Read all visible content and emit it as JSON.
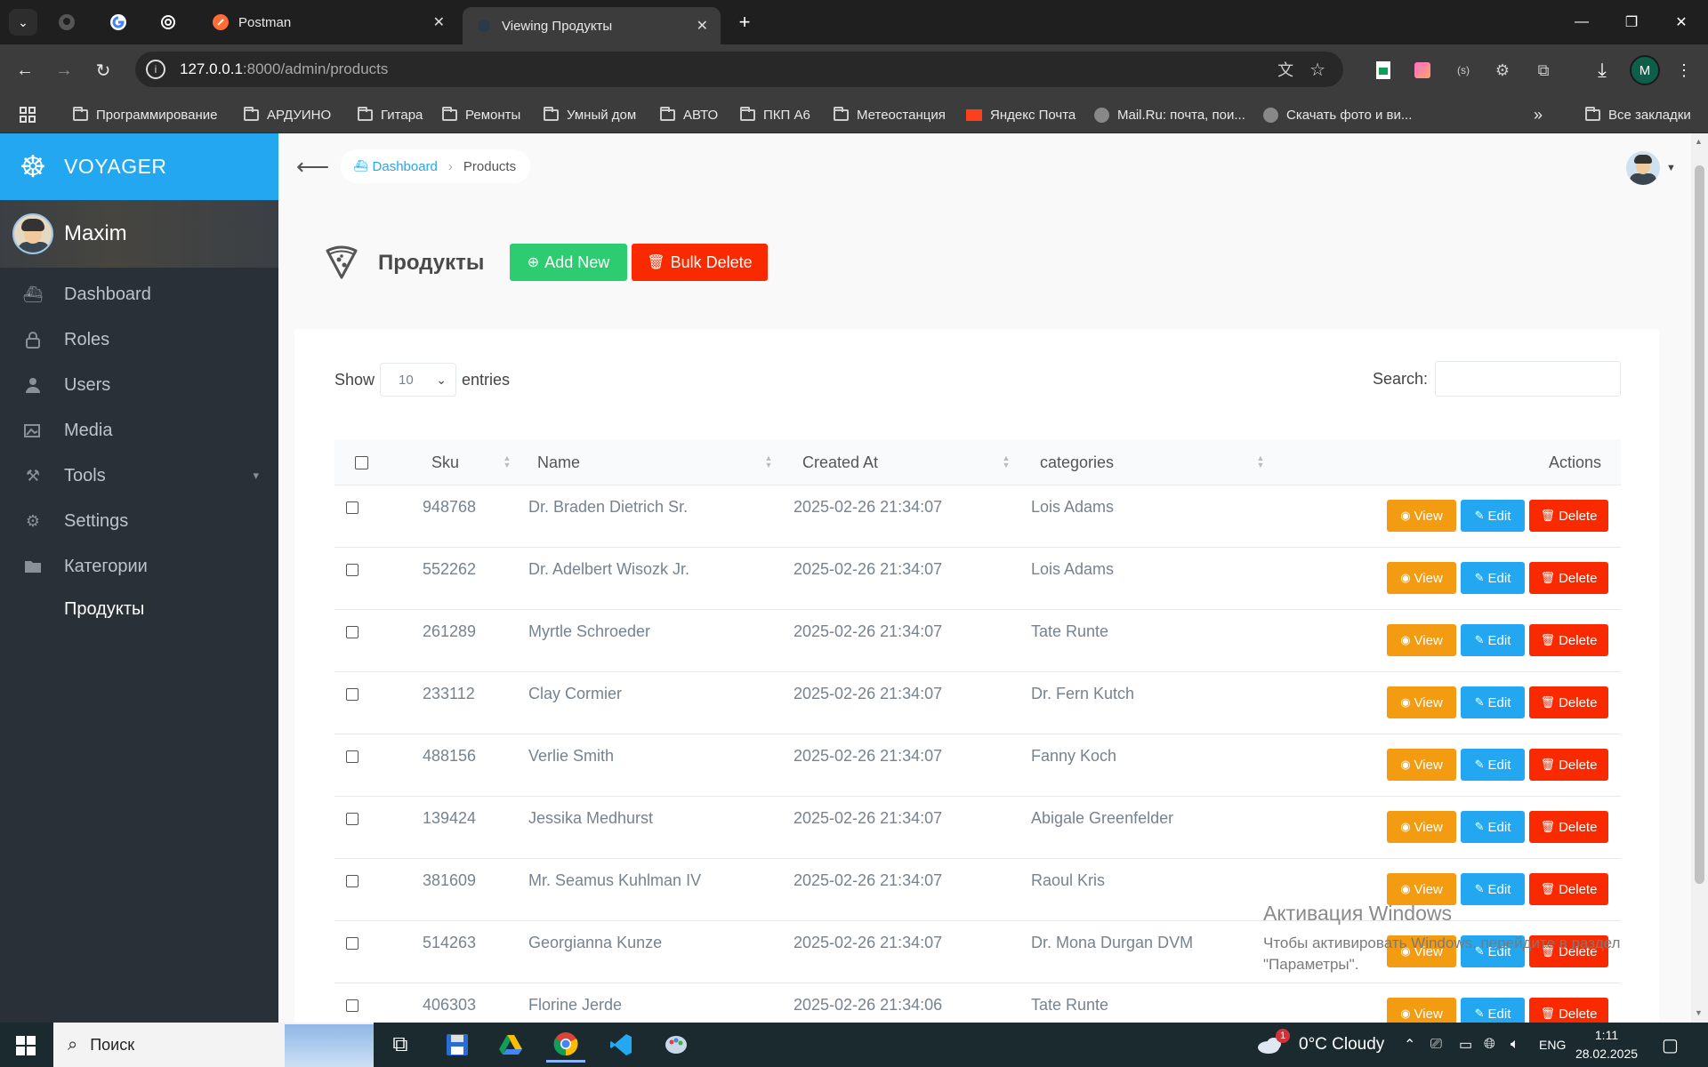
{
  "browser": {
    "tabs": [
      {
        "title": "Postman"
      },
      {
        "title": "Viewing Продукты"
      }
    ],
    "url_host": "127.0.0.1",
    "url_path": ":8000/admin/products",
    "profile_initial": "M",
    "bookmarks": [
      "Программирование",
      "АРДУИНО",
      "Гитара",
      "Ремонты",
      "Умный дом",
      "АВТО",
      "ПКП А6",
      "Метеостанция",
      "Яндекс Почта",
      "Mail.Ru: почта, пои...",
      "Скачать фото и ви...",
      "Все закладки"
    ]
  },
  "sidebar": {
    "brand": "VOYAGER",
    "user": "Maxim",
    "items": [
      {
        "label": "Dashboard",
        "icon": "boat-icon"
      },
      {
        "label": "Roles",
        "icon": "lock-icon"
      },
      {
        "label": "Users",
        "icon": "person-icon"
      },
      {
        "label": "Media",
        "icon": "images-icon"
      },
      {
        "label": "Tools",
        "icon": "tools-icon"
      },
      {
        "label": "Settings",
        "icon": "gear-icon"
      },
      {
        "label": "Категории",
        "icon": "folder-icon"
      },
      {
        "label": "Продукты",
        "icon": ""
      }
    ]
  },
  "topbar": {
    "breadcrumb": {
      "home": "Dashboard",
      "current": "Products"
    }
  },
  "page": {
    "title": "Продукты",
    "add_new": "Add New",
    "bulk_delete": "Bulk Delete"
  },
  "table": {
    "show_label": "Show",
    "entries_value": "10",
    "entries_label": "entries",
    "search_label": "Search:",
    "columns": {
      "sku": "Sku",
      "name": "Name",
      "created_at": "Created At",
      "categories": "categories",
      "actions": "Actions"
    },
    "action_labels": {
      "view": "View",
      "edit": "Edit",
      "delete": "Delete"
    },
    "rows": [
      {
        "sku": "948768",
        "name": "Dr. Braden Dietrich Sr.",
        "created_at": "2025-02-26 21:34:07",
        "category": "Lois Adams"
      },
      {
        "sku": "552262",
        "name": "Dr. Adelbert Wisozk Jr.",
        "created_at": "2025-02-26 21:34:07",
        "category": "Lois Adams"
      },
      {
        "sku": "261289",
        "name": "Myrtle Schroeder",
        "created_at": "2025-02-26 21:34:07",
        "category": "Tate Runte"
      },
      {
        "sku": "233112",
        "name": "Clay Cormier",
        "created_at": "2025-02-26 21:34:07",
        "category": "Dr. Fern Kutch"
      },
      {
        "sku": "488156",
        "name": "Verlie Smith",
        "created_at": "2025-02-26 21:34:07",
        "category": "Fanny Koch"
      },
      {
        "sku": "139424",
        "name": "Jessika Medhurst",
        "created_at": "2025-02-26 21:34:07",
        "category": "Abigale Greenfelder"
      },
      {
        "sku": "381609",
        "name": "Mr. Seamus Kuhlman IV",
        "created_at": "2025-02-26 21:34:07",
        "category": "Raoul Kris"
      },
      {
        "sku": "514263",
        "name": "Georgianna Kunze",
        "created_at": "2025-02-26 21:34:07",
        "category": "Dr. Mona Durgan DVM"
      },
      {
        "sku": "406303",
        "name": "Florine Jerde",
        "created_at": "2025-02-26 21:34:06",
        "category": "Tate Runte"
      }
    ]
  },
  "watermark": {
    "title": "Активация Windows",
    "text": "Чтобы активировать Windows, перейдите в раздел \"Параметры\"."
  },
  "taskbar": {
    "search_placeholder": "Поиск",
    "weather": "0°C Cloudy",
    "weather_badge": "1",
    "language": "ENG",
    "time": "1:11",
    "date": "28.02.2025"
  },
  "colors": {
    "voyager_blue": "#22a7f0",
    "sidebar": "#2a3038",
    "add_green": "#2ecc71",
    "delete_red": "#fa2a00",
    "view_orange": "#f39c12"
  }
}
